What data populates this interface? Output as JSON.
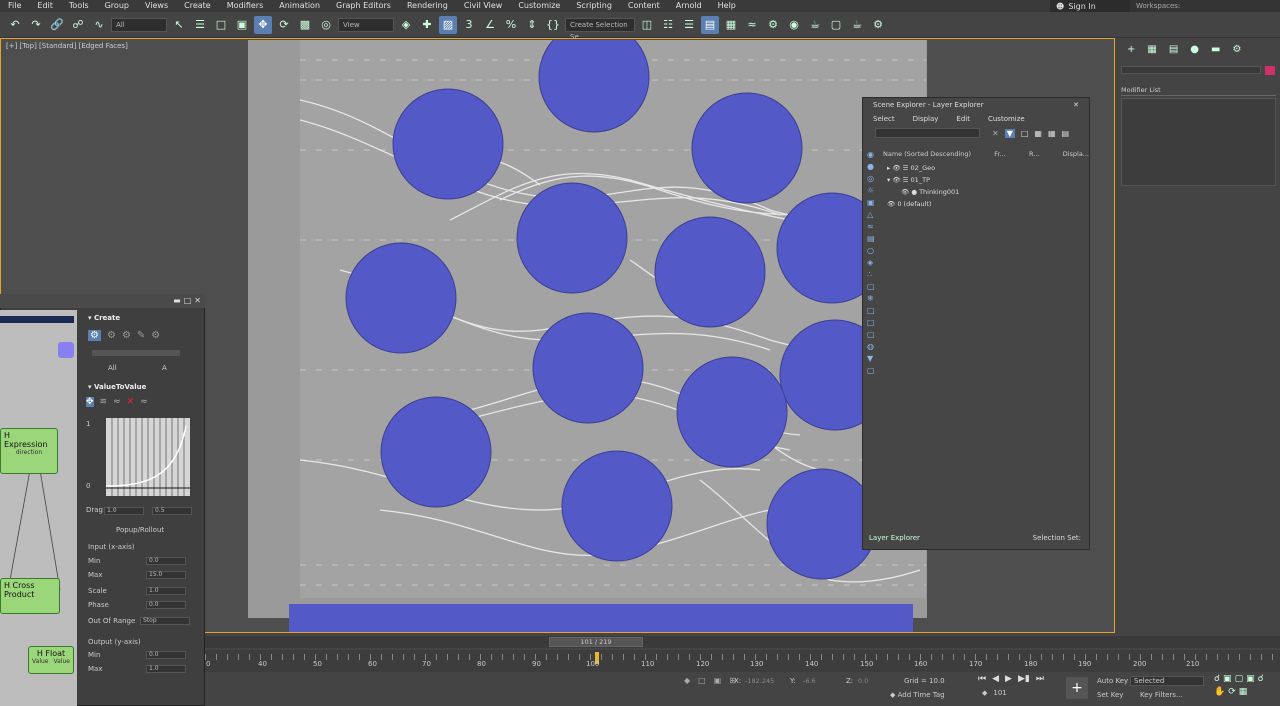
{
  "menubar": {
    "items": [
      "File",
      "Edit",
      "Tools",
      "Group",
      "Views",
      "Create",
      "Modifiers",
      "Animation",
      "Graph Editors",
      "Rendering",
      "Civil View",
      "Customize",
      "Scripting",
      "Content",
      "Arnold",
      "Help"
    ],
    "signin": "Sign In",
    "workspaces": "Workspaces:"
  },
  "toolbar": {
    "filter_value": "All",
    "view_value": "View",
    "selection_set_placeholder": "Create Selection Se"
  },
  "viewport": {
    "label": "[+] [Top] [Standard] [Edged Faces]"
  },
  "scene_explorer": {
    "title": "Scene Explorer - Layer Explorer",
    "menus": [
      "Select",
      "Display",
      "Edit",
      "Customize"
    ],
    "columns": [
      "Name (Sorted Descending)",
      "Fr...",
      "R...",
      "Displa..."
    ],
    "rows": [
      {
        "name": "02_Geo",
        "indent": 0
      },
      {
        "name": "01_TP",
        "indent": 0
      },
      {
        "name": "Thinking001",
        "indent": 1
      },
      {
        "name": "0 (default)",
        "indent": 0
      }
    ],
    "footer_label": "Layer Explorer",
    "selection_set": "Selection Set:"
  },
  "command_panel": {
    "modifier_list": "Modifier List"
  },
  "particle_view": {
    "create_label": "Create",
    "create_all": "All",
    "create_a": "A",
    "nodes": [
      "H Expression",
      "direction",
      "H Cross Product",
      "H Float",
      "Value",
      "Value"
    ],
    "operator_title": "ValueToValue",
    "curve_max": "1",
    "curve_min": "0",
    "drag_label": "Drag",
    "drag_min": "1.0",
    "drag_max": "0.5",
    "popup_label": "Popup/Rollout",
    "input_section": "Input (x-axis)",
    "input_fields": [
      {
        "label": "Min",
        "value": "0.0"
      },
      {
        "label": "Max",
        "value": "15.0"
      },
      {
        "label": "Scale",
        "value": "1.0"
      },
      {
        "label": "Phase",
        "value": "0.0"
      },
      {
        "label": "Out Of Range",
        "value": "Stop"
      }
    ],
    "output_section": "Output (y-axis)",
    "output_fields": [
      {
        "label": "Min",
        "value": "0.0"
      },
      {
        "label": "Max",
        "value": "1.0"
      }
    ]
  },
  "timeline": {
    "frame_display": "101 / 219",
    "ticks": [
      "0",
      "40",
      "50",
      "60",
      "70",
      "80",
      "90",
      "100",
      "110",
      "120",
      "130",
      "140",
      "150",
      "160",
      "170",
      "180",
      "190",
      "200",
      "210"
    ]
  },
  "status": {
    "x_label": "X:",
    "x_value": "-182.245",
    "y_label": "Y:",
    "y_value": "-6.6",
    "z_label": "Z:",
    "z_value": "0.0",
    "grid": "Grid = 10.0",
    "add_time_tag": "Add Time Tag",
    "auto_key": "Auto Key",
    "set_key": "Set Key",
    "selected": "Selected",
    "key_filters": "Key Filters...",
    "frame_field": "101"
  },
  "colors": {
    "circle_blue": "#5459c8",
    "active_border": "#e6a42c",
    "node_green": "#9bd67a"
  }
}
